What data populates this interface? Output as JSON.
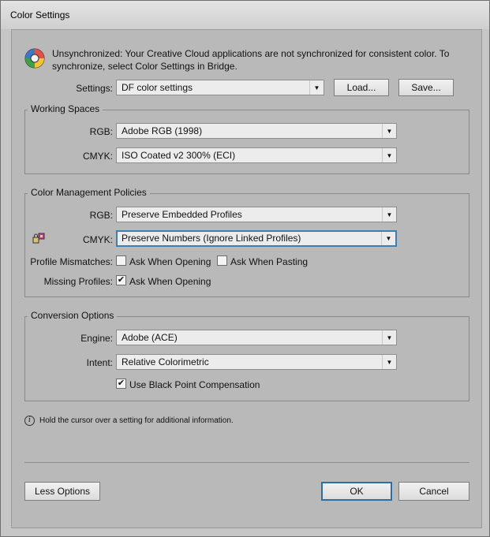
{
  "window": {
    "title": "Color Settings"
  },
  "warning": {
    "icon": "color-wheel-warning-icon",
    "text": "Unsynchronized: Your Creative Cloud applications are not synchronized for consistent color. To synchronize, select Color Settings in Bridge."
  },
  "settings": {
    "label": "Settings:",
    "value": "DF color settings",
    "load_label": "Load...",
    "save_label": "Save..."
  },
  "working_spaces": {
    "title": "Working Spaces",
    "rgb_label": "RGB:",
    "rgb_value": "Adobe RGB (1998)",
    "cmyk_label": "CMYK:",
    "cmyk_value": "ISO Coated v2 300% (ECI)"
  },
  "policies": {
    "title": "Color Management Policies",
    "rgb_label": "RGB:",
    "rgb_value": "Preserve Embedded Profiles",
    "cmyk_label": "CMYK:",
    "cmyk_value": "Preserve Numbers (Ignore Linked Profiles)",
    "mismatch_label": "Profile Mismatches:",
    "ask_opening_label": "Ask When Opening",
    "ask_opening_checked": false,
    "ask_pasting_label": "Ask When Pasting",
    "ask_pasting_checked": false,
    "missing_label": "Missing Profiles:",
    "missing_ask_opening_label": "Ask When Opening",
    "missing_ask_opening_checked": true
  },
  "conversion": {
    "title": "Conversion Options",
    "engine_label": "Engine:",
    "engine_value": "Adobe (ACE)",
    "intent_label": "Intent:",
    "intent_value": "Relative Colorimetric",
    "bpc_label": "Use Black Point Compensation",
    "bpc_checked": true
  },
  "info": {
    "text": "Hold the cursor over a setting for additional information."
  },
  "footer": {
    "less_options_label": "Less Options",
    "ok_label": "OK",
    "cancel_label": "Cancel"
  }
}
